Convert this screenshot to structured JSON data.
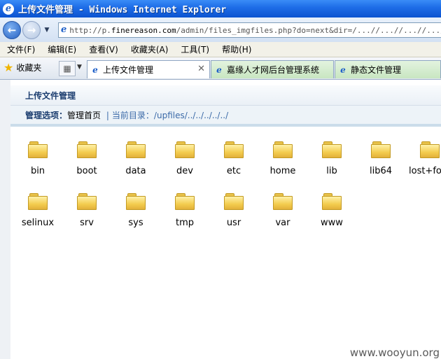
{
  "window": {
    "title": "上传文件管理 - Windows Internet Explorer"
  },
  "navigation": {
    "back_icon": "back-arrow-icon",
    "forward_icon": "forward-arrow-icon",
    "url_prefix": "http://p.",
    "url_domain": "finereason.com",
    "url_rest": "/admin/files_imgfiles.php?do=next&dir=/...//...//...//...//...//"
  },
  "menu": {
    "items": [
      "文件(F)",
      "编辑(E)",
      "查看(V)",
      "收藏夹(A)",
      "工具(T)",
      "帮助(H)"
    ]
  },
  "tabs": {
    "favorites_label": "收藏夹",
    "items": [
      {
        "label": "上传文件管理",
        "active": true
      },
      {
        "label": "嘉缘人才网后台管理系统",
        "active": false
      },
      {
        "label": "静态文件管理",
        "active": false
      }
    ]
  },
  "page": {
    "section_title": "上传文件管理",
    "options_label": "管理选项：",
    "options_link": "管理首页",
    "separator": "|",
    "current_dir_label": "当前目录：",
    "current_dir_path": "/upfiles/../../../../../"
  },
  "folders": [
    "bin",
    "boot",
    "data",
    "dev",
    "etc",
    "home",
    "lib",
    "lib64",
    "lost+found",
    "selinux",
    "srv",
    "sys",
    "tmp",
    "usr",
    "var",
    "www"
  ],
  "watermark": "www.wooyun.org",
  "colors": {
    "titlebar": "#1f6ee8",
    "section_text": "#1b3d6f",
    "path_link": "#3b6aa8",
    "folder_yellow": "#f3cc4e"
  }
}
